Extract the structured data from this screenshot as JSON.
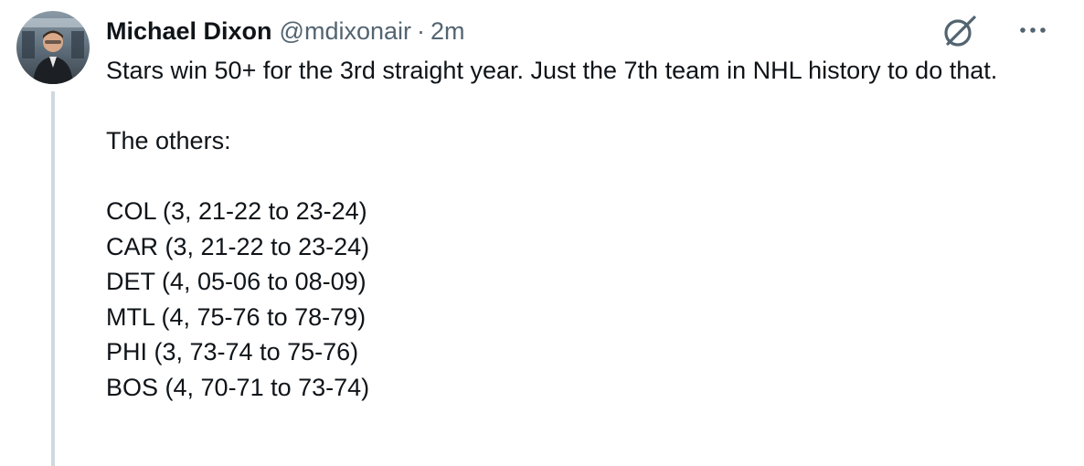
{
  "tweet": {
    "author_name": "Michael Dixon",
    "author_handle": "@mdixonair",
    "separator": "·",
    "timestamp": "2m",
    "text_line_1": "Stars win 50+ for the 3rd straight year. Just the 7th team in NHL history to do that.",
    "text_line_2": "The others:",
    "teams": [
      "COL (3, 21-22 to 23-24)",
      "CAR (3, 21-22 to 23-24)",
      "DET (4, 05-06 to 08-09)",
      "MTL (4, 75-76 to 78-79)",
      "PHI (3, 73-74 to 75-76)",
      "BOS (4, 70-71 to 73-74)"
    ]
  },
  "icons": {
    "avatar": "avatar-photo",
    "grok": "grok-icon",
    "more": "more-options-icon"
  },
  "colors": {
    "primary_text": "#0f1419",
    "secondary_text": "#536471",
    "thread_line": "#cfd9de"
  }
}
